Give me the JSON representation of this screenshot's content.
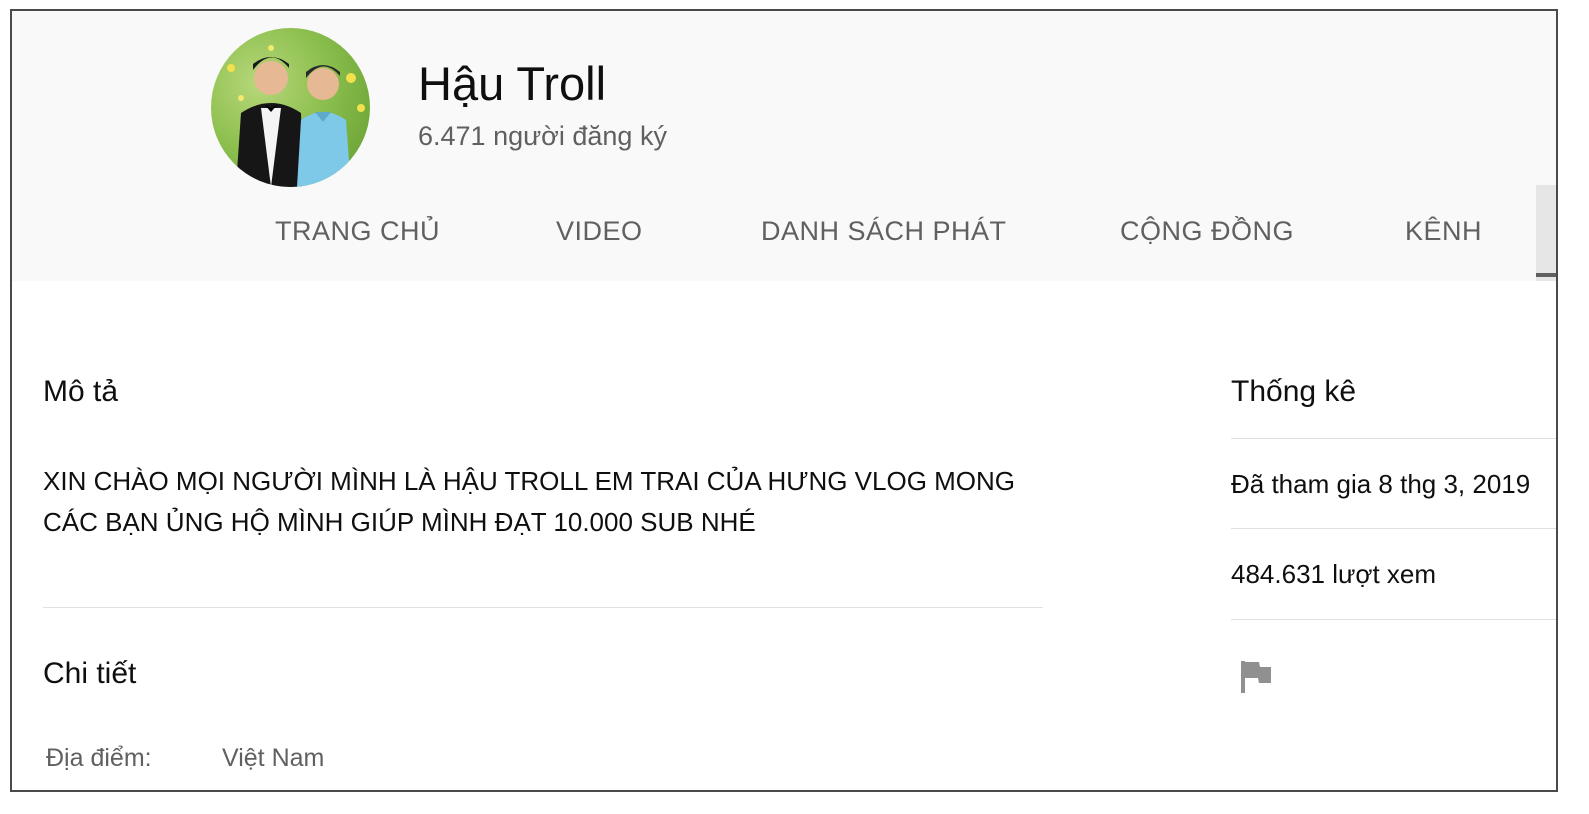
{
  "channel": {
    "name": "Hậu Troll",
    "subscribers": "6.471 người đăng ký"
  },
  "tabs": [
    {
      "label": "TRANG CHỦ"
    },
    {
      "label": "VIDEO"
    },
    {
      "label": "DANH SÁCH PHÁT"
    },
    {
      "label": "CỘNG ĐỒNG"
    },
    {
      "label": "KÊNH"
    }
  ],
  "description": {
    "title": "Mô tả",
    "text": "XIN CHÀO MỌI NGƯỜI MÌNH LÀ HẬU TROLL EM TRAI CỦA HƯNG VLOG MONG CÁC BẠN ỦNG HỘ MÌNH GIÚP MÌNH ĐẠT 10.000 SUB NHÉ"
  },
  "details": {
    "title": "Chi tiết",
    "location_label": "Địa điểm:",
    "location_value": "Việt Nam"
  },
  "stats": {
    "title": "Thống kê",
    "joined": "Đã tham gia 8 thg 3, 2019",
    "views": "484.631 lượt xem"
  },
  "icons": {
    "report": "flag-icon"
  },
  "colors": {
    "header_bg": "#f9f9f9",
    "secondary_text": "#606060",
    "primary_text": "#0f0f0f"
  }
}
